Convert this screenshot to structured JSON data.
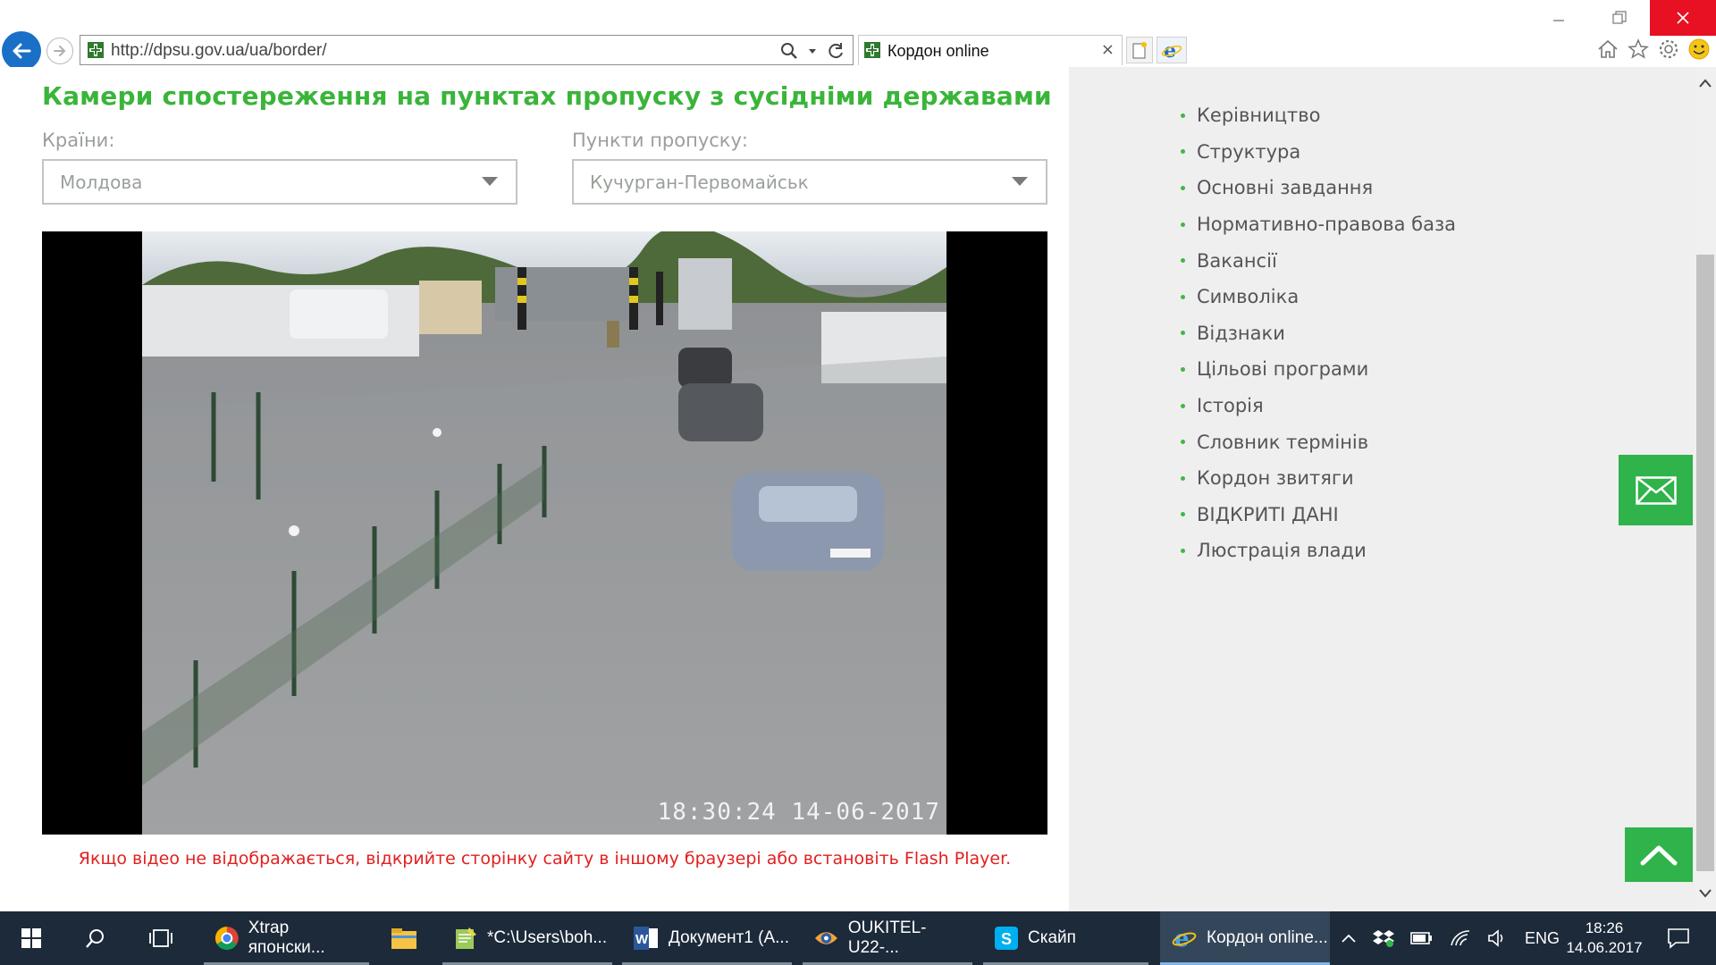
{
  "browser": {
    "url": "http://dpsu.gov.ua/ua/border/",
    "tab_title": "Кордон online",
    "tab_close": "×"
  },
  "page": {
    "title": "Камери спостереження на пунктах пропуску з сусідніми державами",
    "countries_label": "Країни:",
    "country_selected": "Молдова",
    "checkpoints_label": "Пункти пропуску:",
    "checkpoint_selected": "Кучурган-Первомайськ",
    "video_timestamp": "18:30:24  14-06-2017",
    "flash_note": "Якщо відео не відображається, відкрийте сторінку сайту в іншому браузері або встановіть Flash Player."
  },
  "sidebar": {
    "items": [
      {
        "label": "Керівництво"
      },
      {
        "label": "Структура"
      },
      {
        "label": "Основні завдання"
      },
      {
        "label": "Нормативно-правова база"
      },
      {
        "label": "Вакансії"
      },
      {
        "label": "Символіка"
      },
      {
        "label": "Відзнаки"
      },
      {
        "label": "Цільові програми"
      },
      {
        "label": "Історія"
      },
      {
        "label": "Словник термінів"
      },
      {
        "label": "Кордон звитяги"
      },
      {
        "label": "ВІДКРИТІ ДАНІ"
      },
      {
        "label": "Люстрація влади"
      }
    ]
  },
  "taskbar": {
    "apps": [
      {
        "label": "Xtrap японски...",
        "icon": "chrome-icon"
      },
      {
        "label": "",
        "icon": "file-explorer-icon"
      },
      {
        "label": "*C:\\Users\\boh...",
        "icon": "notepad-icon"
      },
      {
        "label": "Документ1 (А...",
        "icon": "word-icon"
      },
      {
        "label": "OUKITEL-U22-...",
        "icon": "app-eye-icon"
      },
      {
        "label": "Скайп",
        "icon": "skype-icon"
      },
      {
        "label": "Кордон online...",
        "icon": "ie-icon"
      }
    ],
    "language": "ENG",
    "time": "18:26",
    "date": "14.06.2017"
  },
  "colors": {
    "accent_green": "#3ab53a",
    "button_green": "#2fb34a",
    "note_red": "#e21f1f",
    "ie_blue": "#1a6fc7",
    "taskbar": "#1c2a3a"
  }
}
